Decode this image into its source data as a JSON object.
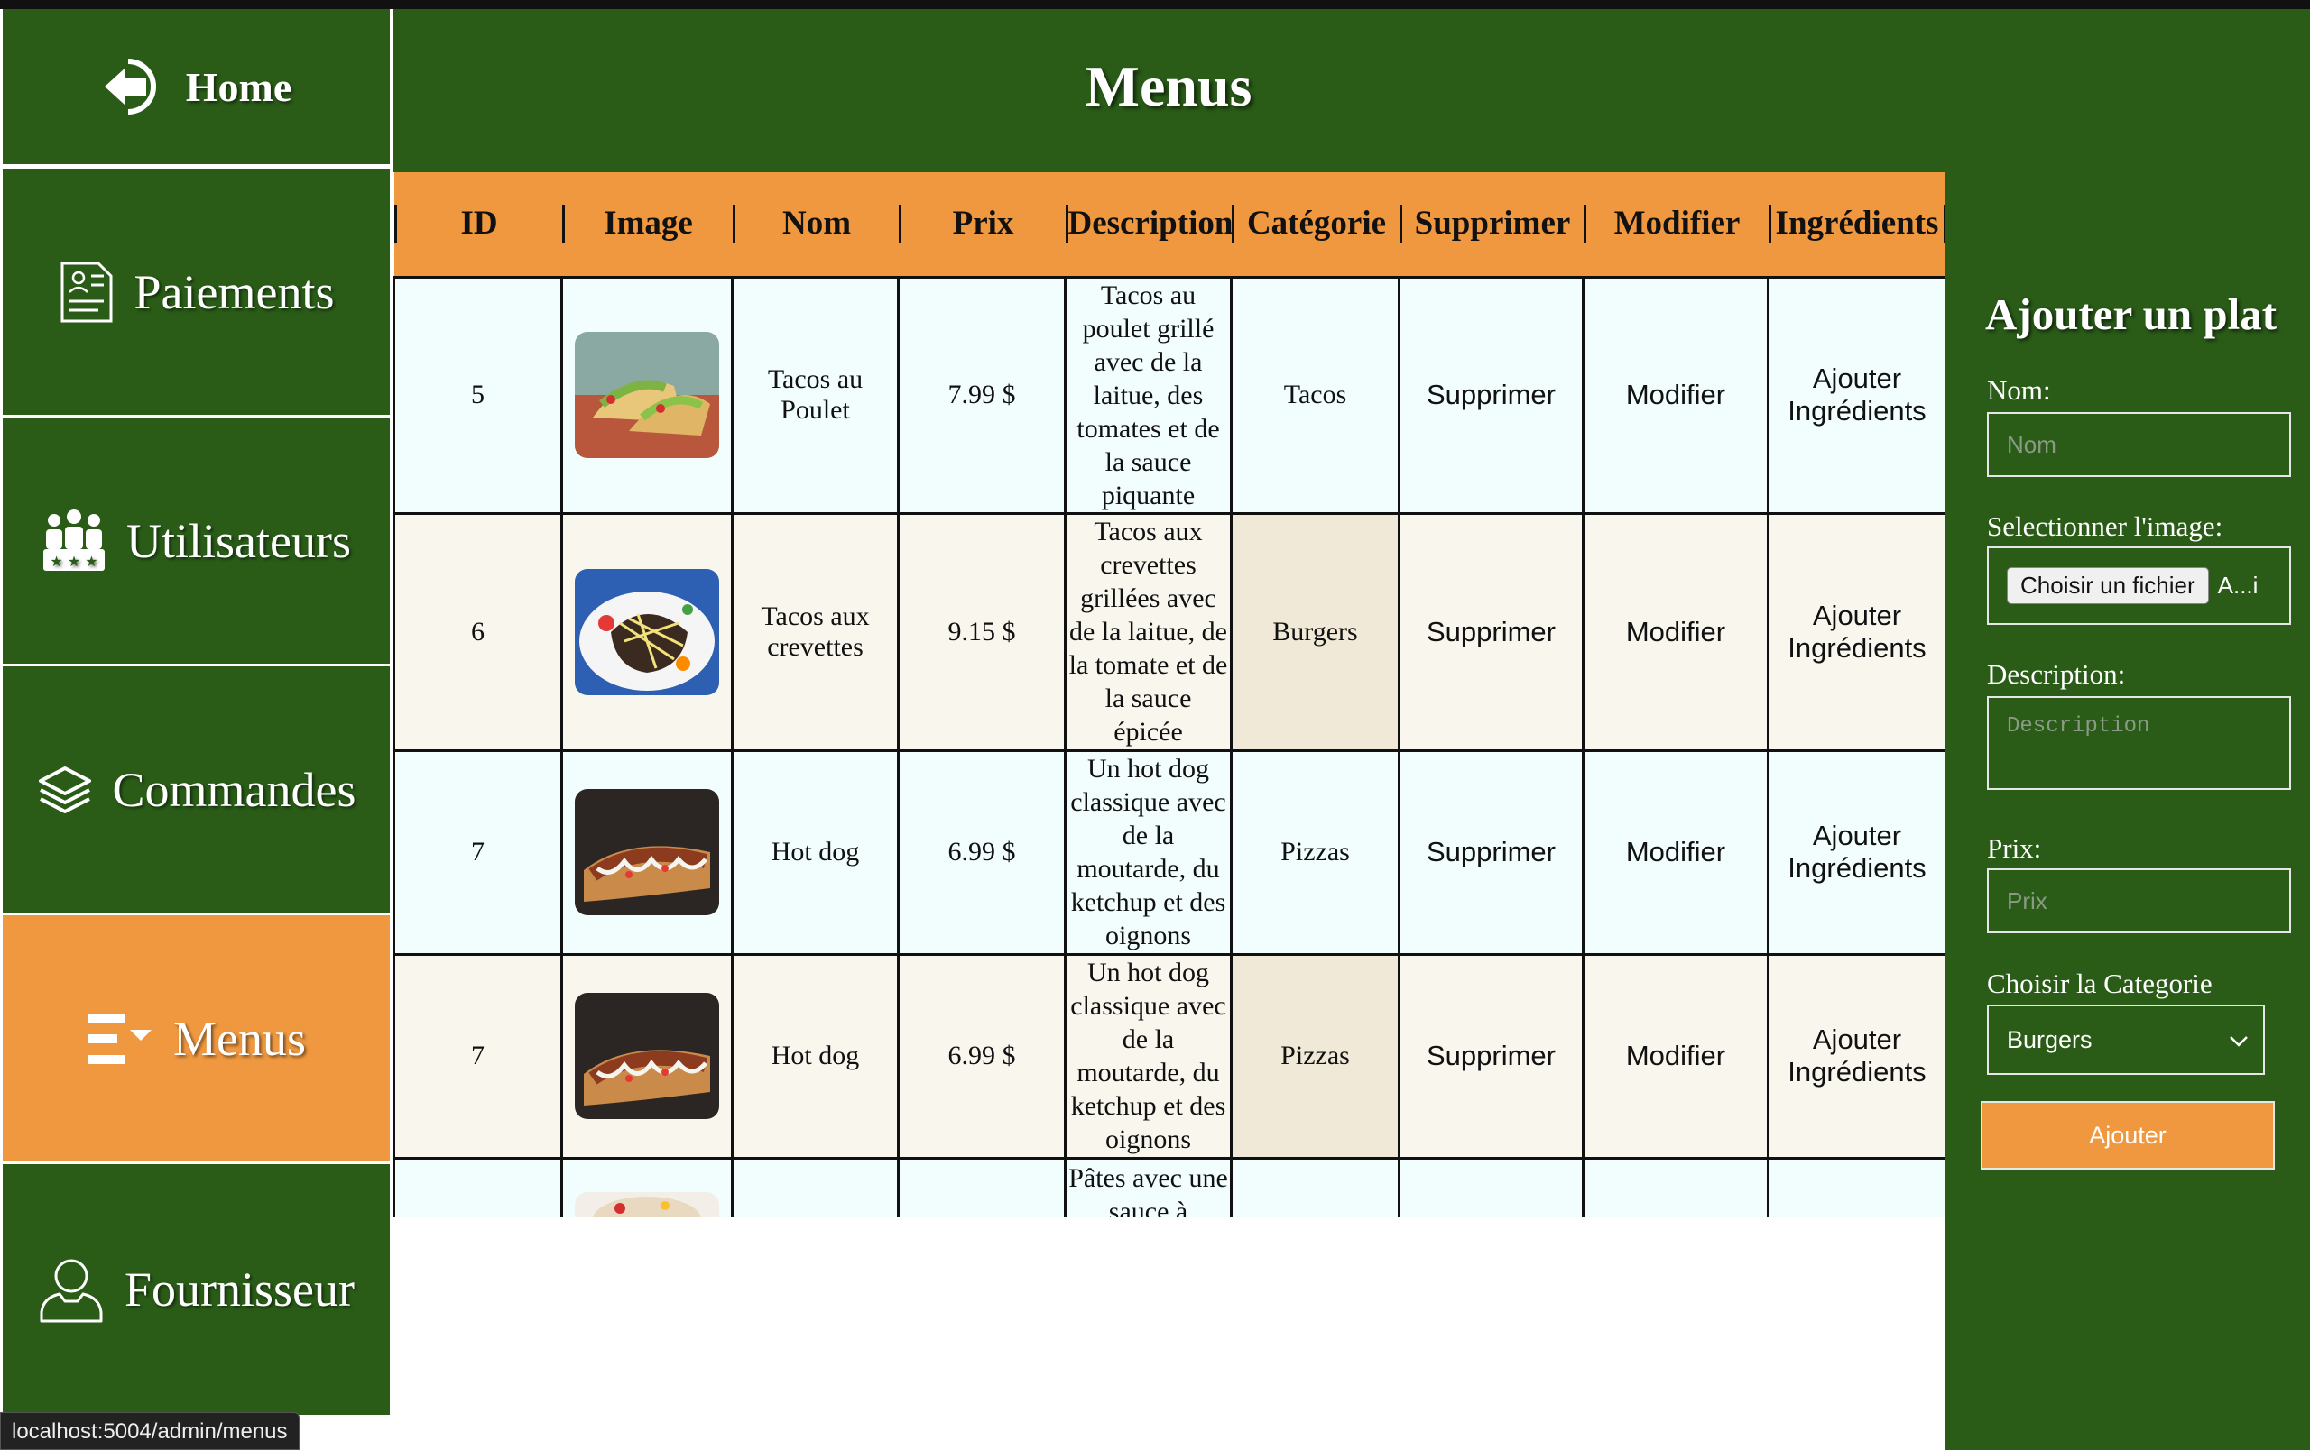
{
  "sidebar": {
    "items": [
      {
        "label": "Home",
        "icon": "arrow-left-circle-icon"
      },
      {
        "label": "Paiements",
        "icon": "receipt-icon"
      },
      {
        "label": "Utilisateurs",
        "icon": "users-group-icon"
      },
      {
        "label": "Commandes",
        "icon": "layers-icon"
      },
      {
        "label": "Menus",
        "icon": "menu-list-icon",
        "active": true
      },
      {
        "label": "Fournisseur",
        "icon": "user-icon"
      }
    ]
  },
  "status_bar": {
    "url": "localhost:5004/admin/menus"
  },
  "main": {
    "title": "Menus",
    "table": {
      "headers": [
        "ID",
        "Image",
        "Nom",
        "Prix",
        "Description",
        "Catégorie",
        "Supprimer",
        "Modifier",
        "Ingrédients"
      ],
      "rows": [
        {
          "id": "5",
          "image": "tacos-photo",
          "nom": "Tacos au Poulet",
          "prix": "7.99 $",
          "description": "Tacos au poulet grillé avec de la laitue, des tomates et de la sauce piquante",
          "categorie": "Tacos",
          "supprimer": "Supprimer",
          "modifier": "Modifier",
          "ingredients": "Ajouter Ingrédients"
        },
        {
          "id": "6",
          "image": "shrimp-tacos-photo",
          "nom": "Tacos aux crevettes",
          "prix": "9.15 $",
          "description": "Tacos aux crevettes grillées avec de la laitue, de la tomate et de la sauce épicée",
          "categorie": "Burgers",
          "supprimer": "Supprimer",
          "modifier": "Modifier",
          "ingredients": "Ajouter Ingrédients"
        },
        {
          "id": "7",
          "image": "hotdog-photo",
          "nom": "Hot dog",
          "prix": "6.99 $",
          "description": "Un hot dog classique avec de la moutarde, du ketchup et des oignons",
          "categorie": "Pizzas",
          "supprimer": "Supprimer",
          "modifier": "Modifier",
          "ingredients": "Ajouter Ingrédients"
        },
        {
          "id": "7",
          "image": "hotdog-photo",
          "nom": "Hot dog",
          "prix": "6.99 $",
          "description": "Un hot dog classique avec de la moutarde, du ketchup et des oignons",
          "categorie": "Pizzas",
          "supprimer": "Supprimer",
          "modifier": "Modifier",
          "ingredients": "Ajouter Ingrédients"
        },
        {
          "id": "",
          "image": "pasta-photo",
          "nom": "",
          "prix": "",
          "description": "Pâtes avec une sauce à",
          "categorie": "",
          "supprimer": "",
          "modifier": "",
          "ingredients": ""
        }
      ]
    }
  },
  "form": {
    "title": "Ajouter un plat",
    "nom_label": "Nom:",
    "nom_placeholder": "Nom",
    "image_label": "Selectionner l'image:",
    "file_button": "Choisir un fichier",
    "file_name": "A...i",
    "description_label": "Description:",
    "description_placeholder": "Description",
    "prix_label": "Prix:",
    "prix_placeholder": "Prix",
    "categorie_label": "Choisir la Categorie",
    "categorie_selected": "Burgers",
    "submit_label": "Ajouter"
  },
  "colors": {
    "primary_green": "#2a5c18",
    "accent_orange": "#ef9840",
    "row_light": "#f2fefe",
    "row_beige": "#f9f6ee"
  }
}
